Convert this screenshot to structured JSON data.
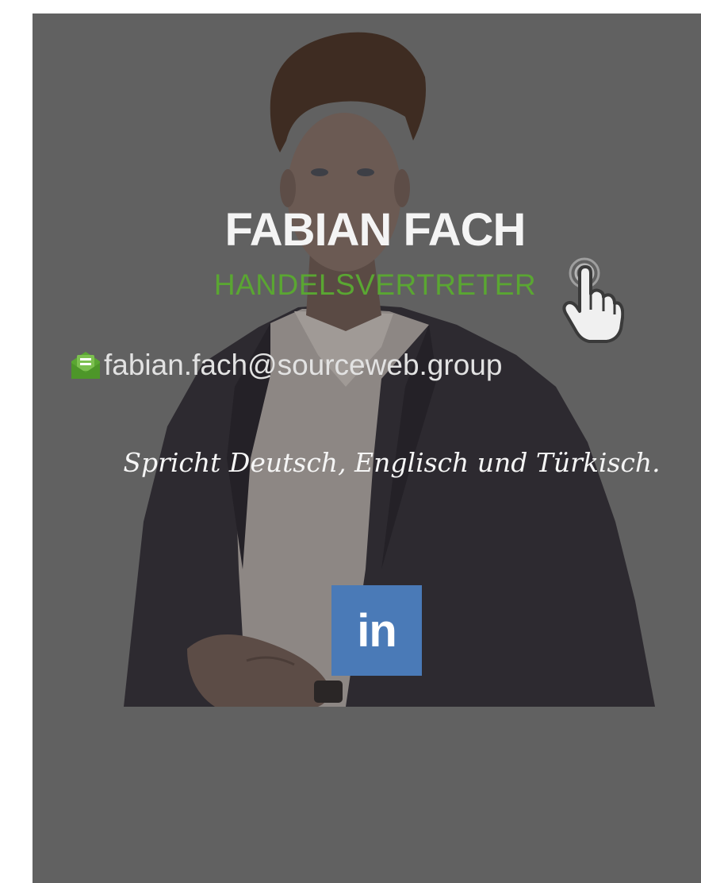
{
  "profile": {
    "name": "FABIAN FACH",
    "role": "HANDELSVERTRETER",
    "email": "fabian.fach@sourceweb.group",
    "languages": "Spricht Deutsch, Englisch und Türkisch.",
    "linkedin_label": "in"
  },
  "colors": {
    "card_background": "#616161",
    "role_accent": "#5aa632",
    "linkedin_blue": "#4a7ab7",
    "email_icon": "#5aa632"
  },
  "icons": {
    "email": "envelope-letter-icon",
    "social": "linkedin-icon",
    "cursor": "hand-pointer-cursor-icon"
  }
}
